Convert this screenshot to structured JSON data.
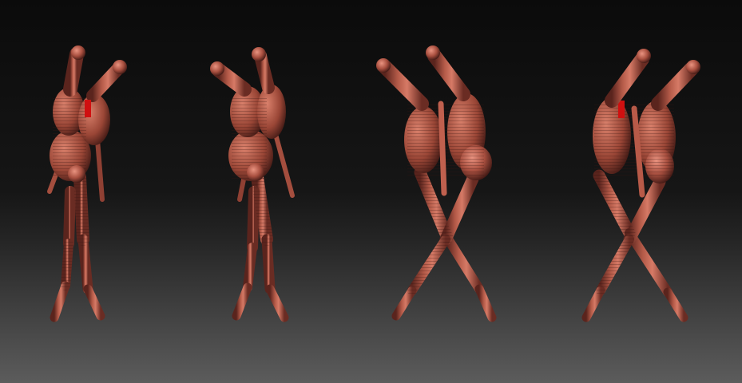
{
  "scene": {
    "description_visible_text": "",
    "colors": {
      "background_top": "#0e0e0e",
      "background_mid": "#1a1a1a",
      "background_bottom": "#5a5a5a",
      "clay_light": "#c9705e",
      "clay_mid": "#9a4a3c",
      "clay_dark": "#4a1f1a",
      "accent_red": "#d01010"
    },
    "figures": [
      {
        "id": "figure-1",
        "pose": "legs-apart"
      },
      {
        "id": "figure-2",
        "pose": "legs-apart"
      },
      {
        "id": "figure-3",
        "pose": "legs-crossed"
      },
      {
        "id": "figure-4",
        "pose": "legs-crossed"
      }
    ]
  }
}
